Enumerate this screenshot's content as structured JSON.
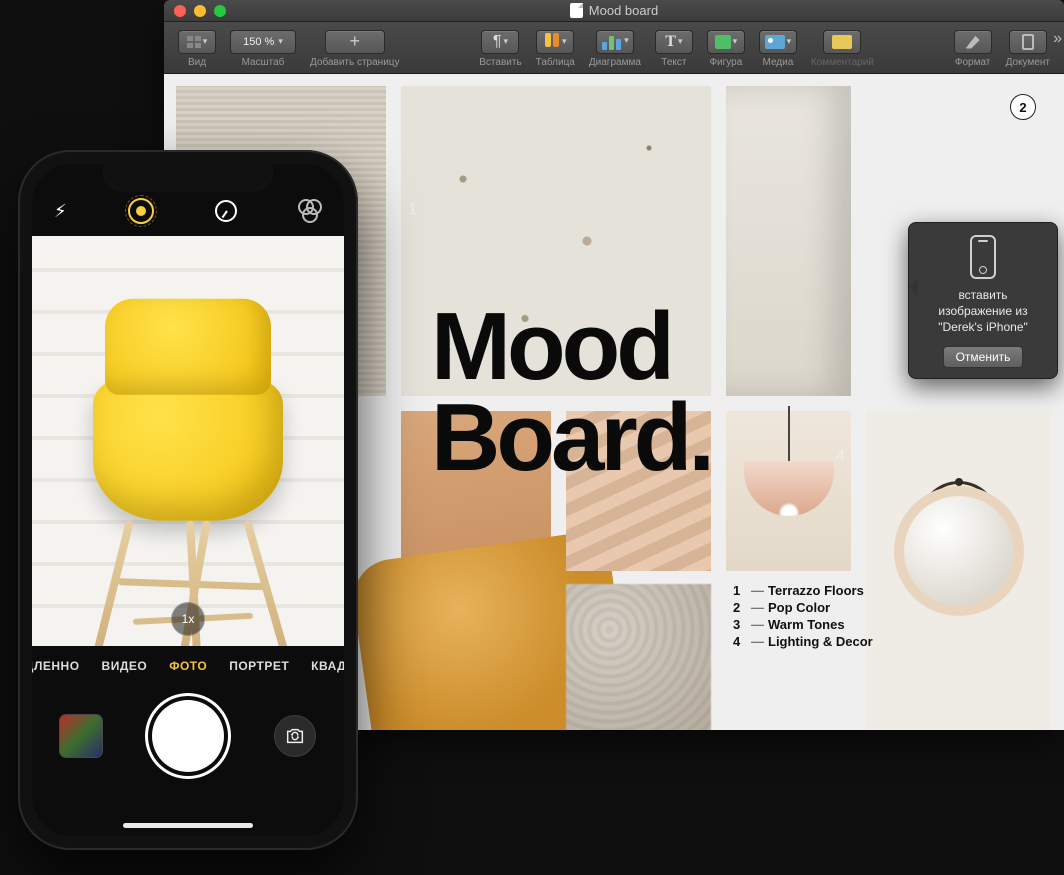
{
  "window": {
    "title": "Mood board",
    "traffic": [
      "close",
      "minimize",
      "zoom"
    ]
  },
  "toolbar": {
    "view": "Вид",
    "zoom_label": "Масштаб",
    "zoom_value": "150 %",
    "add_page": "Добавить страницу",
    "insert": "Вставить",
    "table": "Таблица",
    "chart": "Диаграмма",
    "text": "Текст",
    "shape": "Фигура",
    "media": "Медиа",
    "comment": "Комментарий",
    "format": "Формат",
    "document": "Документ"
  },
  "doc": {
    "headline_l1": "Mood",
    "headline_l2": "Board.",
    "marker1": "1",
    "marker2": "2",
    "marker4": "4",
    "legend": [
      {
        "n": "1",
        "t": "Terrazzo Floors"
      },
      {
        "n": "2",
        "t": "Pop Color"
      },
      {
        "n": "3",
        "t": "Warm Tones"
      },
      {
        "n": "4",
        "t": "Lighting & Decor"
      }
    ]
  },
  "popover": {
    "line1": "вставить",
    "line2": "изображение из",
    "line3": "\"Derek's iPhone\"",
    "cancel": "Отменить"
  },
  "iphone": {
    "zoom": "1x",
    "modes": {
      "slow": "МЕДЛЕННО",
      "video": "ВИДЕО",
      "photo": "ФОТО",
      "portrait": "ПОРТРЕТ",
      "square": "КВАДРАТ"
    }
  }
}
